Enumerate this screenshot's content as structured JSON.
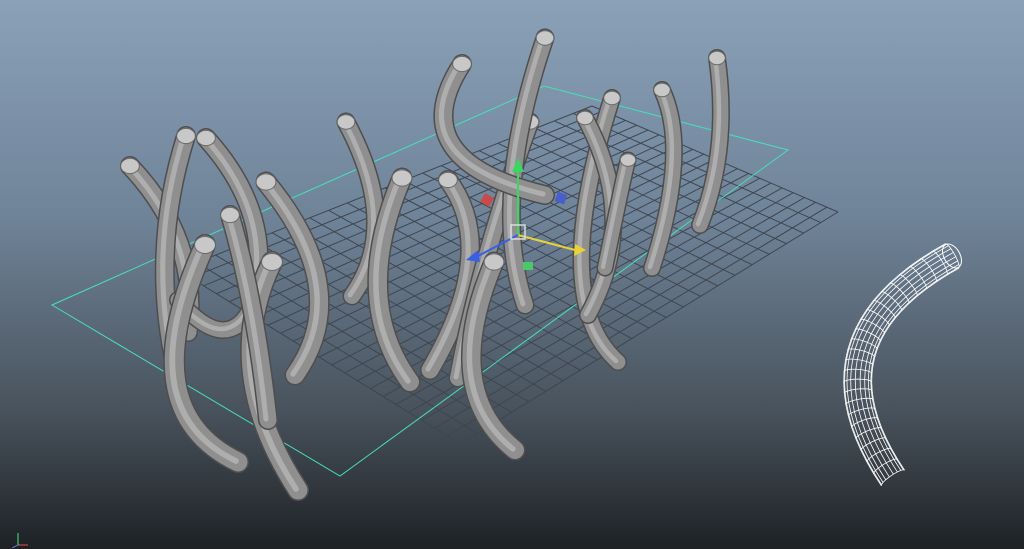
{
  "viewport": {
    "view_axis_labels": {
      "x": "",
      "y": "",
      "z": ""
    }
  },
  "colors": {
    "background_top": "#8aa1b8",
    "background_bottom": "#1d2124",
    "grid_line": "#3e4650",
    "grid_border": "#46e0b8",
    "tube_fill": "#8f8f8f",
    "wireframe": "#ffffff",
    "axis_x": "#e8d23a",
    "axis_y": "#3ad85e",
    "axis_z": "#3a5ee8"
  },
  "icons": {
    "manipulator": "move-manipulator-icon",
    "view_axis": "view-axis-icon"
  }
}
